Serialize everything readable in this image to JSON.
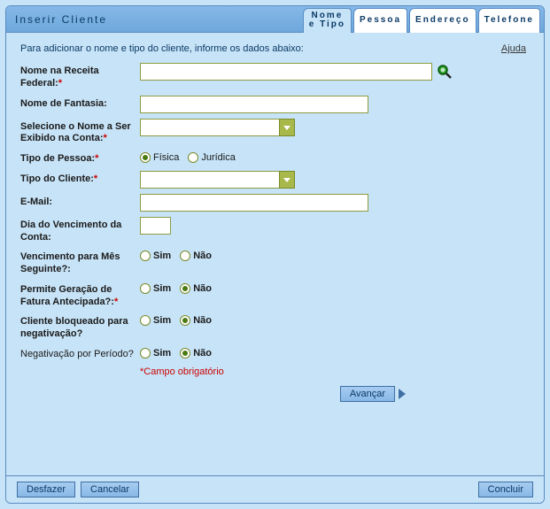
{
  "title": "Inserir Cliente",
  "tabs": {
    "nome_tipo": "Nome\ne Tipo",
    "pessoa": "Pessoa",
    "endereco": "Endereço",
    "telefone": "Telefone"
  },
  "instruction": "Para adicionar o nome e tipo do cliente, informe os dados abaixo:",
  "help": "Ajuda",
  "labels": {
    "nome_receita": "Nome na Receita Federal:",
    "nome_fantasia": "Nome de Fantasia:",
    "nome_exibido": "Selecione o Nome a Ser Exibido na Conta:",
    "tipo_pessoa": "Tipo de Pessoa:",
    "tipo_cliente": "Tipo do Cliente:",
    "email": "E-Mail:",
    "dia_venc": "Dia do Vencimento da Conta:",
    "venc_mes_seg": "Vencimento para Mês Seguinte?:",
    "fatura_antec": "Permite Geração de Fatura Antecipada?:",
    "cliente_bloq": "Cliente bloqueado para negativação?",
    "neg_periodo": "Negativação por Período?"
  },
  "options": {
    "fisica": "Física",
    "juridica": "Jurídica",
    "sim": "Sim",
    "nao": "Não"
  },
  "values": {
    "nome_receita": "",
    "nome_fantasia": "",
    "nome_exibido": "",
    "tipo_cliente": "",
    "email": "",
    "dia_venc": "",
    "tipo_pessoa": "Física",
    "venc_mes_seg": "",
    "fatura_antec": "Não",
    "cliente_bloq": "Não",
    "neg_periodo": "Não"
  },
  "req_note": "*Campo obrigatório",
  "buttons": {
    "avancar": "Avançar",
    "desfazer": "Desfazer",
    "cancelar": "Cancelar",
    "concluir": "Concluir"
  }
}
